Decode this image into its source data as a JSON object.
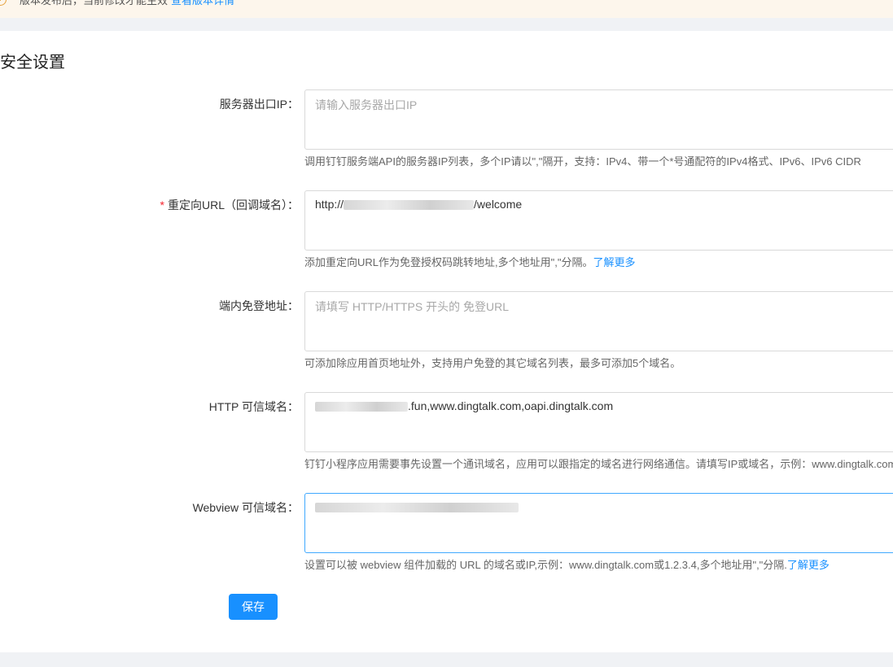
{
  "notice": {
    "text": "版本发布后，当前修改才能生效",
    "link": "查看版本详情",
    "icon": "warning-circle-icon"
  },
  "page_title": "安全设置",
  "fields": {
    "server_ip": {
      "label": "服务器出口IP：",
      "placeholder": "请输入服务器出口IP",
      "help": "调用钉钉服务端API的服务器IP列表，多个IP请以\",\"隔开，支持：IPv4、带一个*号通配符的IPv4格式、IPv6、IPv6 CIDR"
    },
    "redirect_url": {
      "required_mark": "*",
      "label": "重定向URL（回调域名）：",
      "value_prefix": "http://",
      "value_suffix": "/welcome",
      "help": "添加重定向URL作为免登授权码跳转地址,多个地址用\",\"分隔。",
      "help_link": "了解更多"
    },
    "sso_address": {
      "label": "端内免登地址：",
      "placeholder": "请填写 HTTP/HTTPS 开头的 免登URL",
      "help": "可添加除应用首页地址外，支持用户免登的其它域名列表，最多可添加5个域名。"
    },
    "http_domain": {
      "label": "HTTP 可信域名：",
      "value_suffix": ".fun,www.dingtalk.com,oapi.dingtalk.com",
      "help": "钉钉小程序应用需要事先设置一个通讯域名，应用可以跟指定的域名进行网络通信。请填写IP或域名，示例：www.dingtalk.com"
    },
    "webview_domain": {
      "label": "Webview 可信域名：",
      "help": "设置可以被 webview 组件加载的 URL 的域名或IP,示例：www.dingtalk.com或1.2.3.4,多个地址用\",\"分隔.",
      "help_link": "了解更多"
    }
  },
  "save_button": "保存",
  "colors": {
    "accent": "#1890ff",
    "required": "#f5222d",
    "notice_bg": "#fdf6ec",
    "warning": "#e6a23c"
  }
}
